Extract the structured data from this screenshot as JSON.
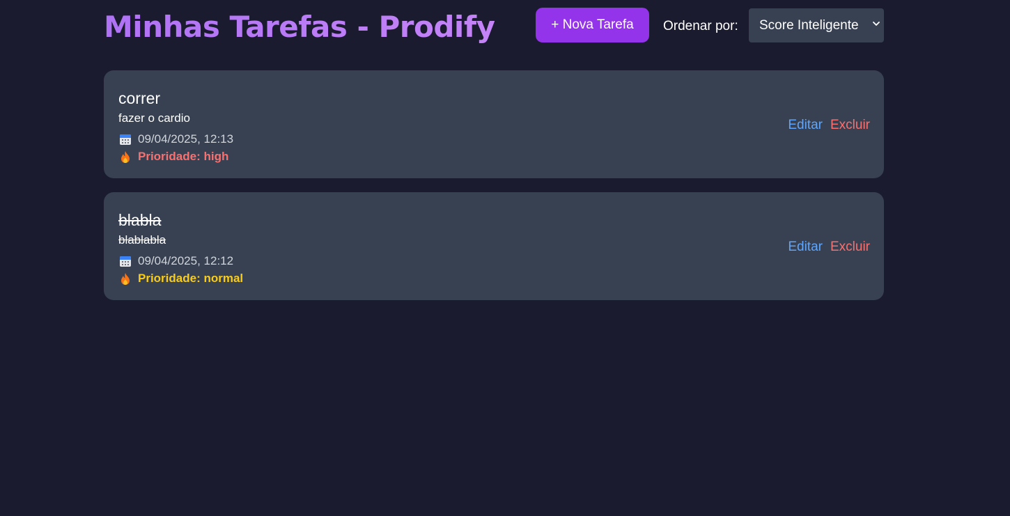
{
  "header": {
    "title": "Minhas Tarefas - Prodify",
    "new_task_label": "+ Nova Tarefa",
    "sort_label": "Ordenar por:",
    "sort_selected": "Score Inteligente"
  },
  "tasks": [
    {
      "title": "correr",
      "description": "fazer o cardio",
      "datetime": "09/04/2025, 12:13",
      "priority": "Prioridade: high",
      "priority_color": "#f87171",
      "completed": false,
      "edit_label": "Editar",
      "delete_label": "Excluir"
    },
    {
      "title": "blabla",
      "description": "blablabla",
      "datetime": "09/04/2025, 12:12",
      "priority": "Prioridade: normal",
      "priority_color": "#facc15",
      "completed": true,
      "edit_label": "Editar",
      "delete_label": "Excluir"
    }
  ],
  "colors": {
    "background": "#1a1b2e",
    "card": "#374151",
    "accent": "#9333ea",
    "title_gradient_start": "#b072f5",
    "edit": "#60a5fa",
    "delete": "#f87171"
  },
  "icons": {
    "date": "calendar-icon",
    "priority": "fire-icon",
    "select": "chevron-down-icon"
  }
}
